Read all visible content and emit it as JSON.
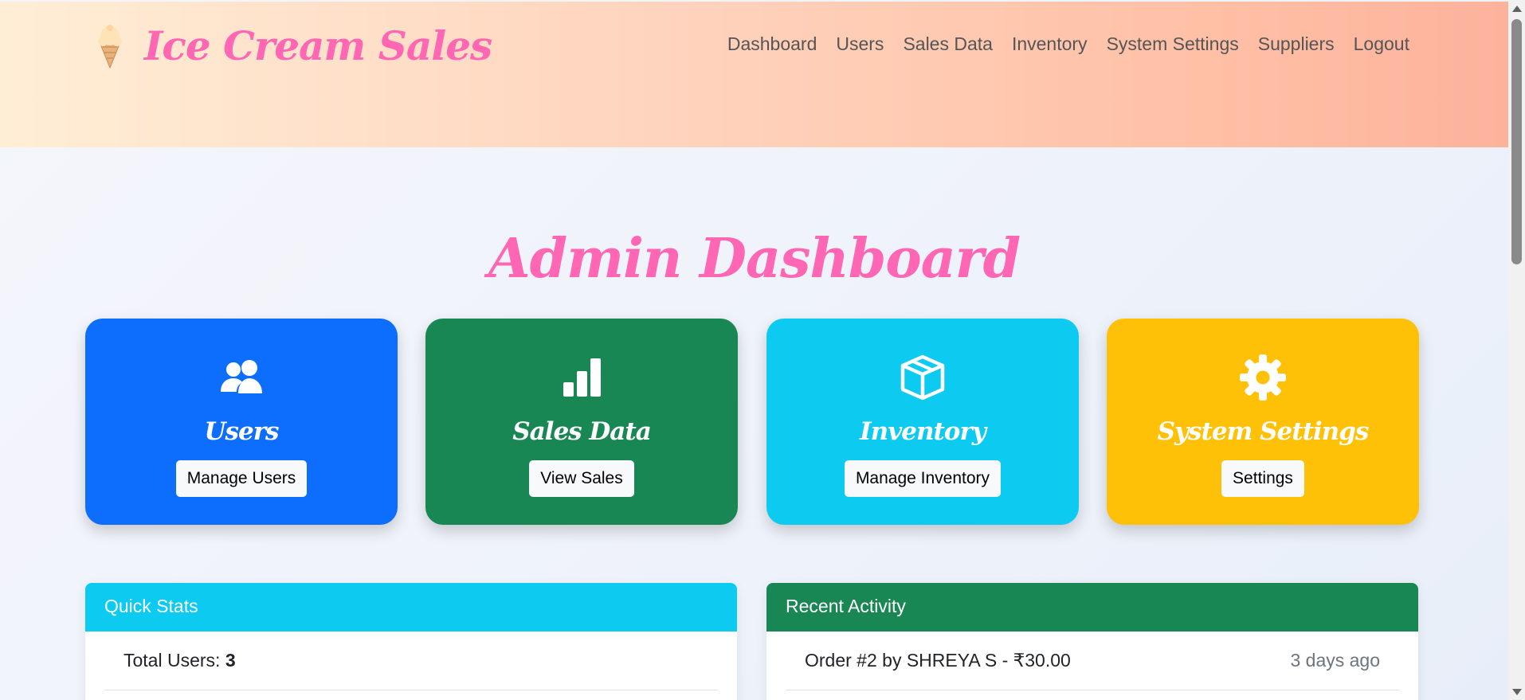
{
  "header": {
    "brand_icon": "ice-cream-icon",
    "brand": "Ice Cream Sales",
    "nav": [
      "Dashboard",
      "Users",
      "Sales Data",
      "Inventory",
      "System Settings",
      "Suppliers",
      "Logout"
    ]
  },
  "main": {
    "title": "Admin Dashboard",
    "cards": [
      {
        "title": "Users",
        "button": "Manage Users",
        "icon": "users-icon",
        "color": "#0d6efd"
      },
      {
        "title": "Sales Data",
        "button": "View Sales",
        "icon": "bar-chart-icon",
        "color": "#198754"
      },
      {
        "title": "Inventory",
        "button": "Manage Inventory",
        "icon": "box-icon",
        "color": "#0dcaf0"
      },
      {
        "title": "System Settings",
        "button": "Settings",
        "icon": "gear-icon",
        "color": "#ffc107"
      }
    ]
  },
  "quick_stats": {
    "header": "Quick Stats",
    "total_users_label": "Total Users:",
    "total_users_value": "3"
  },
  "recent_activity": {
    "header": "Recent Activity",
    "items": [
      {
        "text": "Order #2 by SHREYA S - ₹30.00",
        "time": "3 days ago"
      }
    ]
  },
  "colors": {
    "brand_pink": "#ff66b3",
    "primary": "#0d6efd",
    "success": "#198754",
    "info": "#0dcaf0",
    "warning": "#ffc107"
  }
}
